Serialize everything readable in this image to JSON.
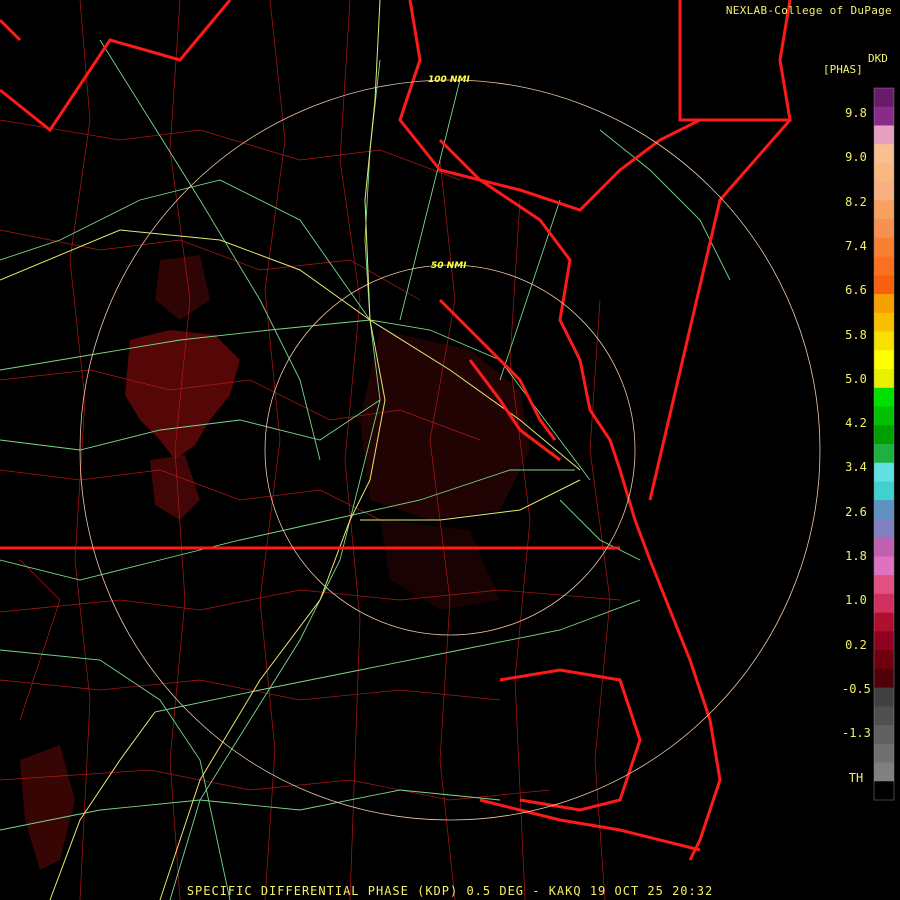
{
  "header": {
    "credit": "NEXLAB-College of DuPage"
  },
  "legend": {
    "units_top": "DKD",
    "units_bottom": "[PHAS]",
    "ticks": [
      "9.8",
      "9.0",
      "8.2",
      "7.4",
      "6.6",
      "5.8",
      "5.0",
      "4.2",
      "3.4",
      "2.6",
      "1.8",
      "1.0",
      "0.2",
      "-0.5",
      "-1.3",
      "TH"
    ],
    "colors": [
      "#6a1a6a",
      "#8a2a8a",
      "#e8a0c0",
      "#f8c090",
      "#f8b880",
      "#f8b080",
      "#f8a060",
      "#f89050",
      "#f88030",
      "#f87020",
      "#f86010",
      "#f8a000",
      "#f8c000",
      "#f8e000",
      "#ffff00",
      "#e8f000",
      "#00e000",
      "#00c000",
      "#00a000",
      "#20b040",
      "#60e0e0",
      "#40d0d0",
      "#6090c0",
      "#8080c0",
      "#c060b0",
      "#e070c0",
      "#e05080",
      "#d03060",
      "#b01030",
      "#900020",
      "#700010",
      "#500008",
      "#404040",
      "#505050",
      "#606060",
      "#707070",
      "#808080",
      "#000000"
    ]
  },
  "map": {
    "ring_labels": [
      "100 NMI",
      "50 NMI"
    ],
    "colors": {
      "state_border": "#ff1a1a",
      "county": "#b01818",
      "highway": "#7ad88a",
      "interstate": "#e8e870",
      "range_ring": "#f0c8a8",
      "echo": "#6a0a0a"
    }
  },
  "footer": {
    "caption": "SPECIFIC DIFFERENTIAL PHASE (KDP) 0.5 DEG - KAKQ 19 OCT 25 20:32"
  }
}
